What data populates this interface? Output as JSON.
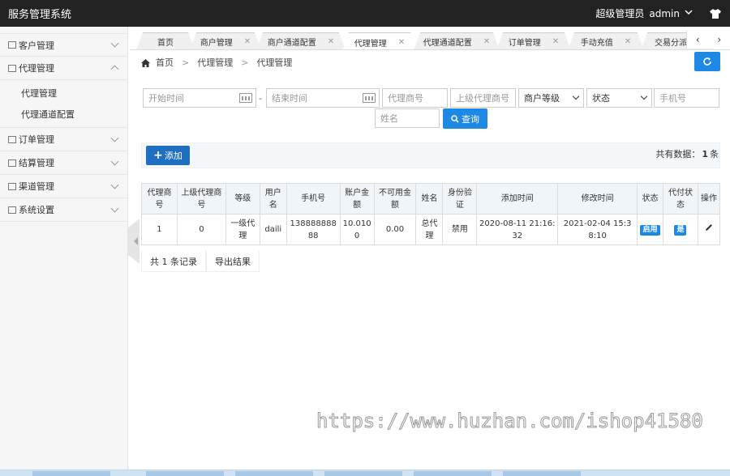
{
  "app": {
    "title": "服务管理系统",
    "role": "超级管理员",
    "user": "admin"
  },
  "sidebar": {
    "items": [
      {
        "label": "客户管理"
      },
      {
        "label": "代理管理",
        "expanded": true,
        "children": [
          "代理管理",
          "代理通道配置"
        ]
      },
      {
        "label": "订单管理"
      },
      {
        "label": "结算管理"
      },
      {
        "label": "渠道管理"
      },
      {
        "label": "系统设置"
      }
    ]
  },
  "tabs": [
    {
      "label": "首页",
      "closable": false
    },
    {
      "label": "商户管理",
      "closable": true
    },
    {
      "label": "商户通道配置",
      "closable": true
    },
    {
      "label": "代理管理",
      "closable": true,
      "active": true
    },
    {
      "label": "代理通道配置",
      "closable": true
    },
    {
      "label": "订单管理",
      "closable": true
    },
    {
      "label": "手动充值",
      "closable": true
    },
    {
      "label": "交易分派",
      "closable": false
    }
  ],
  "tab_nav": {
    "prev": "‹",
    "next": "›"
  },
  "breadcrumb": {
    "home": "首页",
    "level1": "代理管理",
    "level2": "代理管理",
    "sep": ">"
  },
  "search": {
    "start_time": "开始时间",
    "end_time": "结束时间",
    "dash": "-",
    "agent_no": "代理商号",
    "parent_agent_no": "上级代理商号",
    "merchant_level": "商户等级",
    "status": "状态",
    "phone": "手机号",
    "name": "姓名",
    "query_label": "查询"
  },
  "toolbar": {
    "add_label": "添加",
    "total_prefix": "共有数据：",
    "total_count": "1",
    "total_suffix": "条"
  },
  "table": {
    "headers": [
      "代理商号",
      "上级代理商号",
      "等级",
      "用户名",
      "手机号",
      "账户金额",
      "不可用金额",
      "姓名",
      "身份验证",
      "添加时间",
      "修改时间",
      "状态",
      "代付状态",
      "操作"
    ],
    "rows": [
      {
        "agent_no": "1",
        "parent_no": "0",
        "level": "一级代理",
        "username": "daili",
        "phone": "13888888888",
        "balance": "10.0100",
        "frozen": "0.00",
        "name": "总代理",
        "verify": "禁用",
        "created": "2020-08-11 21:16:32",
        "modified": "2021-02-04 15:38:10",
        "status": "启用",
        "pay_status": "是"
      }
    ]
  },
  "footer": {
    "records": "共 1 条记录",
    "export": "导出结果"
  },
  "watermark": "https://www.huzhan.com/ishop41580",
  "colors": {
    "primary": "#1e88e5",
    "topbar": "#222222",
    "add_button": "#1e6fc0"
  }
}
